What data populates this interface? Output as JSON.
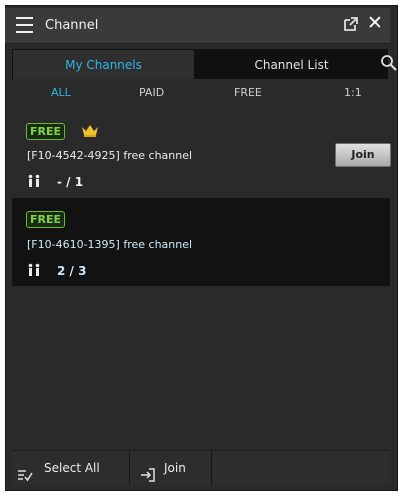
{
  "window": {
    "title": "Channel"
  },
  "tabs": {
    "my_channels": "My Channels",
    "channel_list": "Channel List"
  },
  "filters": [
    {
      "label": "ALL",
      "active": true
    },
    {
      "label": "PAID",
      "active": false
    },
    {
      "label": "FREE",
      "active": false
    },
    {
      "label": "1:1",
      "active": false
    }
  ],
  "channels": [
    {
      "badge": "FREE",
      "name": "[F10-4542-4925] free channel",
      "count": "- / 1",
      "has_crown": true,
      "join_label": "Join"
    },
    {
      "badge": "FREE",
      "name": "[F10-4610-1395] free channel",
      "count": "2 / 3",
      "has_crown": false
    }
  ],
  "footer": {
    "select_all": "Select All",
    "join": "Join"
  },
  "colors": {
    "accent": "#2fb6e8",
    "badge_green": "#7fd14a",
    "crown_gold": "#f2c12e"
  },
  "icons": {
    "menu": "hamburger-icon",
    "popout": "popout-icon",
    "close": "close-icon",
    "search": "search-icon",
    "crown": "crown-icon",
    "users": "users-icon",
    "select_all": "select-all-icon",
    "join": "join-icon"
  }
}
